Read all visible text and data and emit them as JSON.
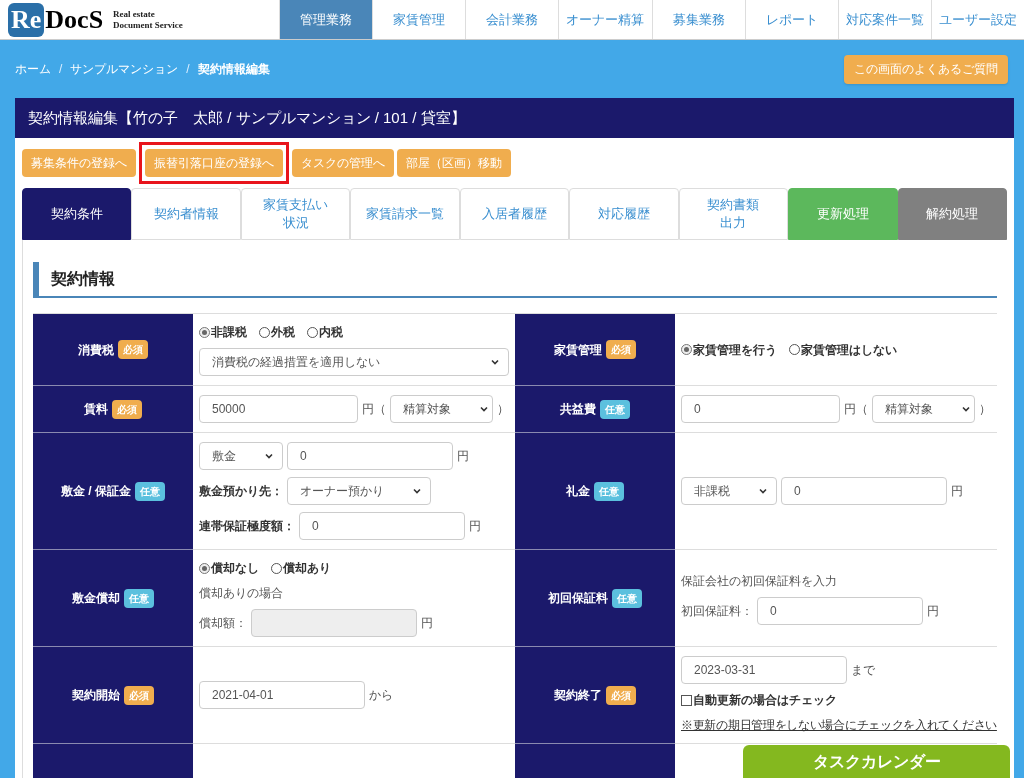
{
  "logo": {
    "mark": "Re",
    "name": "DocS",
    "tagline": [
      "Real estate",
      "Document Service"
    ]
  },
  "nav": [
    {
      "label": "管理業務",
      "selected": true
    },
    {
      "label": "家賃管理",
      "selected": false
    },
    {
      "label": "会計業務",
      "selected": false
    },
    {
      "label": "オーナー精算",
      "selected": false
    },
    {
      "label": "募集業務",
      "selected": false
    },
    {
      "label": "レポート",
      "selected": false
    },
    {
      "label": "対応案件一覧",
      "selected": false
    },
    {
      "label": "ユーザー設定",
      "selected": false
    }
  ],
  "breadcrumb": {
    "items": [
      "ホーム",
      "サンプルマンション",
      "契約情報編集"
    ],
    "separator": "/"
  },
  "faq_button": "この画面のよくあるご質問",
  "panel_title": "契約情報編集【竹の子　太郎 / サンプルマンション / 101 / 貸室】",
  "actions": [
    {
      "label": "募集条件の登録へ",
      "highlighted": false
    },
    {
      "label": "振替引落口座の登録へ",
      "highlighted": true
    },
    {
      "label": "タスクの管理へ",
      "highlighted": false
    },
    {
      "label": "部屋（区画）移動",
      "highlighted": false
    }
  ],
  "tabs": [
    {
      "label": "契約条件",
      "kind": "normal",
      "selected": true
    },
    {
      "label": "契約者情報",
      "kind": "normal",
      "selected": false
    },
    {
      "label": [
        "家賃支払い",
        "状況"
      ],
      "kind": "normal",
      "selected": false
    },
    {
      "label": "家賃請求一覧",
      "kind": "normal",
      "selected": false
    },
    {
      "label": "入居者履歴",
      "kind": "normal",
      "selected": false
    },
    {
      "label": "対応履歴",
      "kind": "normal",
      "selected": false
    },
    {
      "label": [
        "契約書類",
        "出力"
      ],
      "kind": "normal",
      "selected": false
    },
    {
      "label": "更新処理",
      "kind": "renew",
      "selected": false
    },
    {
      "label": "解約処理",
      "kind": "cancel",
      "selected": false
    }
  ],
  "section_title": "契約情報",
  "rows": [
    {
      "cells": [
        {
          "label": "消費税",
          "badge": {
            "text": "必須",
            "kind": "required"
          },
          "lines": [
            [
              {
                "kind": "radio",
                "label": "非課税",
                "selected": true
              },
              {
                "kind": "radio",
                "label": "外税",
                "selected": false
              },
              {
                "kind": "radio",
                "label": "内税",
                "selected": false
              }
            ],
            [
              {
                "kind": "select",
                "value": "消費税の経過措置を適用しない"
              }
            ]
          ]
        },
        {
          "label": "家賃管理",
          "badge": {
            "text": "必須",
            "kind": "required"
          },
          "lines": [
            [
              {
                "kind": "radio",
                "label": "家賃管理を行う",
                "selected": true
              },
              {
                "kind": "radio",
                "label": "家賃管理はしない",
                "selected": false
              }
            ]
          ]
        }
      ]
    },
    {
      "cells": [
        {
          "label": "賃料",
          "badge": {
            "text": "必須",
            "kind": "required"
          },
          "lines": [
            [
              {
                "kind": "input",
                "value": "50000"
              },
              {
                "kind": "text",
                "text": "円（"
              },
              {
                "kind": "select",
                "value": "精算対象"
              },
              {
                "kind": "text",
                "text": "）"
              }
            ]
          ]
        },
        {
          "label": "共益費",
          "badge": {
            "text": "任意",
            "kind": "optional"
          },
          "lines": [
            [
              {
                "kind": "input",
                "value": "0"
              },
              {
                "kind": "text",
                "text": "円（"
              },
              {
                "kind": "select",
                "value": "精算対象"
              },
              {
                "kind": "text",
                "text": "）"
              }
            ]
          ]
        }
      ]
    },
    {
      "cells": [
        {
          "label": "敷金 / 保証金",
          "badge": {
            "text": "任意",
            "kind": "optional"
          },
          "lines": [
            [
              {
                "kind": "select",
                "value": "敷金"
              },
              {
                "kind": "input",
                "value": "0"
              },
              {
                "kind": "text",
                "text": "円"
              }
            ],
            [
              {
                "kind": "label",
                "text": "敷金預かり先："
              },
              {
                "kind": "select",
                "value": "オーナー預かり"
              }
            ],
            [
              {
                "kind": "label",
                "text": "連帯保証極度額："
              },
              {
                "kind": "input",
                "value": "0"
              },
              {
                "kind": "text",
                "text": "円"
              }
            ]
          ]
        },
        {
          "label": "礼金",
          "badge": {
            "text": "任意",
            "kind": "optional"
          },
          "lines": [
            [
              {
                "kind": "select",
                "value": "非課税"
              },
              {
                "kind": "input",
                "value": "0"
              },
              {
                "kind": "text",
                "text": "円"
              }
            ]
          ]
        }
      ]
    },
    {
      "cells": [
        {
          "label": "敷金償却",
          "badge": {
            "text": "任意",
            "kind": "optional"
          },
          "lines": [
            [
              {
                "kind": "radio",
                "label": "償却なし",
                "selected": true
              },
              {
                "kind": "radio",
                "label": "償却あり",
                "selected": false
              }
            ],
            [
              {
                "kind": "text",
                "text": "償却ありの場合"
              }
            ],
            [
              {
                "kind": "text",
                "text": "償却額："
              },
              {
                "kind": "input",
                "disabled": true
              },
              {
                "kind": "text",
                "text": "円"
              }
            ]
          ]
        },
        {
          "label": "初回保証料",
          "badge": {
            "text": "任意",
            "kind": "optional"
          },
          "lines": [
            [
              {
                "kind": "text",
                "text": "保証会社の初回保証料を入力"
              }
            ],
            [
              {
                "kind": "text",
                "text": "初回保証料："
              },
              {
                "kind": "input",
                "value": "0"
              },
              {
                "kind": "text",
                "text": "円"
              }
            ]
          ]
        }
      ]
    },
    {
      "cells": [
        {
          "label": "契約開始",
          "badge": {
            "text": "必須",
            "kind": "required"
          },
          "lines": [
            [
              {
                "kind": "input",
                "value": "2021-04-01"
              },
              {
                "kind": "text",
                "text": "から"
              }
            ]
          ]
        },
        {
          "label": "契約終了",
          "badge": {
            "text": "必須",
            "kind": "required"
          },
          "lines": [
            [
              {
                "kind": "input",
                "value": "2023-03-31"
              },
              {
                "kind": "text",
                "text": "まで"
              }
            ],
            [
              {
                "kind": "checkbox",
                "label": "自動更新の場合はチェック",
                "checked": false
              }
            ],
            [
              {
                "kind": "note",
                "text": "※更新の期日管理をしない場合にチェックを入れてください"
              }
            ]
          ]
        }
      ]
    }
  ],
  "task_calendar": "タスクカレンダー"
}
